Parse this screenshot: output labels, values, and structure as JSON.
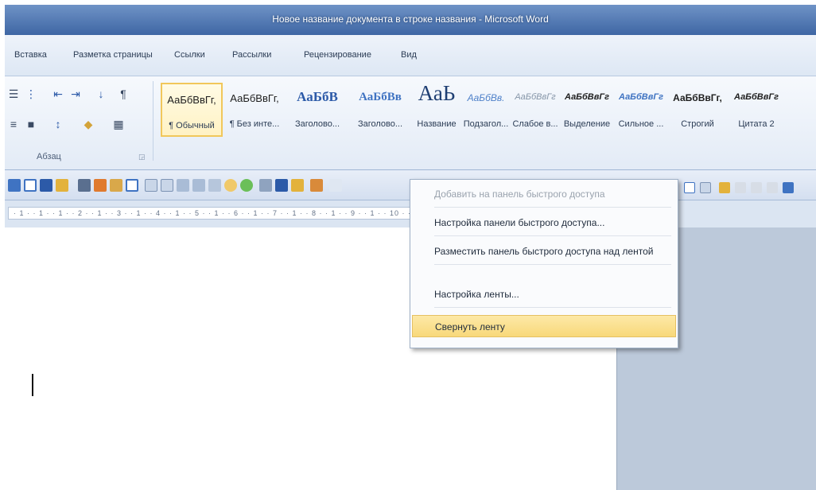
{
  "window": {
    "title": "Новое название документа в строке названия - Microsoft Word"
  },
  "tabs": [
    {
      "label": "Вставка"
    },
    {
      "label": "Разметка страницы"
    },
    {
      "label": "Ссылки"
    },
    {
      "label": "Рассылки"
    },
    {
      "label": "Рецензирование"
    },
    {
      "label": "Вид"
    }
  ],
  "ribbon": {
    "paragraph_group_label": "Абзац",
    "styles": [
      {
        "sample": "АаБбВвГг,",
        "label": "¶ Обычный"
      },
      {
        "sample": "АаБбВвГг,",
        "label": "¶ Без инте..."
      },
      {
        "sample": "АаБбВ",
        "label": "Заголово..."
      },
      {
        "sample": "АаБбВв",
        "label": "Заголово..."
      },
      {
        "sample": "АаЬ",
        "label": "Название"
      },
      {
        "sample": "АаБбВв.",
        "label": "Подзагол..."
      },
      {
        "sample": "АаБбВвГг",
        "label": "Слабое в..."
      },
      {
        "sample": "АаБбВвГг",
        "label": "Выделение"
      },
      {
        "sample": "АаБбВвГг",
        "label": "Сильное ..."
      },
      {
        "sample": "АаБбВвГг,",
        "label": "Строгий"
      },
      {
        "sample": "АаБбВвГг",
        "label": "Цитата 2"
      }
    ]
  },
  "ruler": {
    "ticks": "· 1 · · 1 · · 1 · · 2 · · 1 · · 3 · · 1 · · 4 · · 1 · · 5 · · 1 · · 6 · · 1 · · 7 · · 1 · · 8 · · 1 · · 9 · · 1 · · 10 · · 1 · · 11 · · 1"
  },
  "context_menu": {
    "items": [
      {
        "label": "Добавить на панель быстрого доступа",
        "disabled": true
      },
      {
        "label": "Настройка панели быстрого доступа..."
      },
      {
        "label": "Разместить панель быстрого доступа над лентой"
      },
      {
        "label": "Настройка ленты..."
      },
      {
        "label": "Свернуть ленту",
        "highlighted": true
      }
    ]
  },
  "colors": {
    "title_bar": "#4a70ad",
    "menu_highlight": "#f8d87a",
    "selected_style_border": "#f1c75b"
  }
}
